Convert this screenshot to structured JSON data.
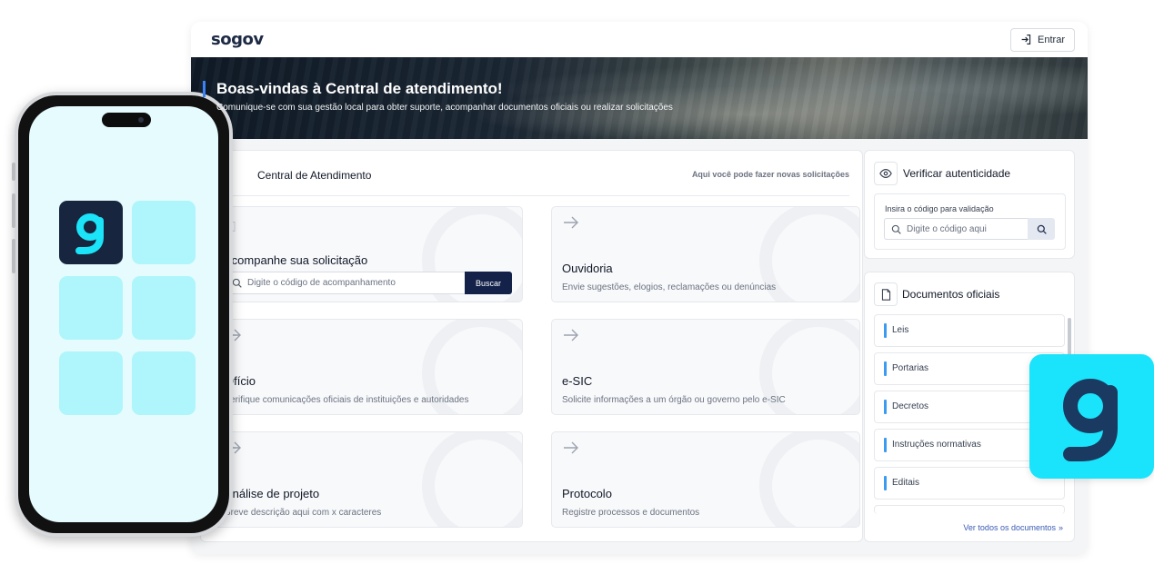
{
  "app": {
    "logo": "sogov",
    "login_label": "Entrar"
  },
  "hero": {
    "title": "Boas-vindas à Central de atendimento!",
    "subtitle": "Comunique-se com sua gestão local para obter suporte, acompanhar documentos oficiais ou realizar solicitações"
  },
  "main": {
    "title": "Central de Atendimento",
    "hint": "Aqui você pode fazer novas solicitações",
    "tracking": {
      "title": "Acompanhe sua solicitação",
      "placeholder": "Digite o código de acompanhamento",
      "button": "Buscar"
    },
    "cards": [
      {
        "title": "Ouvidoria",
        "desc": "Envie sugestões, elogios, reclamações ou denúncias"
      },
      {
        "title": "Ofício",
        "desc": "Verifique comunicações oficiais de instituições e autoridades"
      },
      {
        "title": "e-SIC",
        "desc": "Solicite informações a um órgão ou governo pelo e-SIC"
      },
      {
        "title": "Análise de projeto",
        "desc": "Breve descrição aqui com x caracteres"
      },
      {
        "title": "Protocolo",
        "desc": "Registre processos e documentos"
      }
    ]
  },
  "verify": {
    "title": "Verificar autenticidade",
    "label": "Insira o código para validação",
    "placeholder": "Digite o código aqui"
  },
  "docs": {
    "title": "Documentos oficiais",
    "items": [
      "Leis",
      "Portarias",
      "Decretos",
      "Instruções normativas",
      "Editais"
    ],
    "link": "Ver todos os documentos"
  },
  "colors": {
    "accent": "#3b82f6",
    "navy": "#14224a",
    "cyan": "#19e4fb",
    "dark_app": "#17253e"
  }
}
